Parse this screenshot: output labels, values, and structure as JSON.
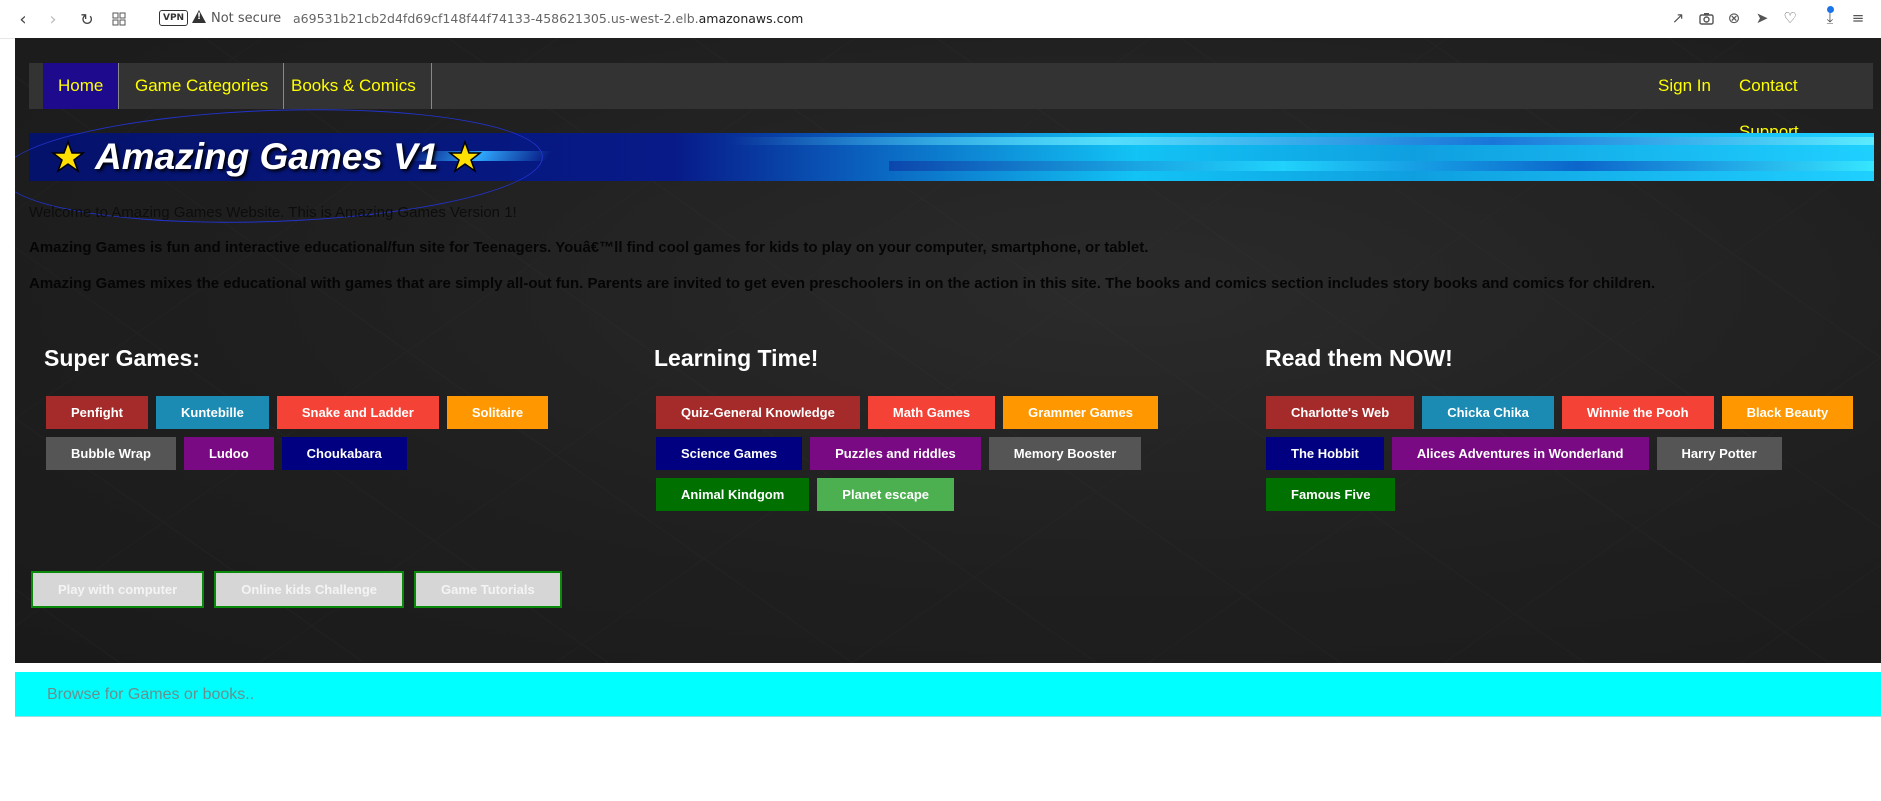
{
  "browser": {
    "vpn_label": "VPN",
    "security_label": "Not secure",
    "url_prefix": "a69531b21cb2d4fd69cf148f44f74133-458621305.us-west-2.elb.",
    "url_domain": "amazonaws.com"
  },
  "nav": {
    "home": "Home",
    "game_categories": "Game Categories",
    "books_comics": "Books & Comics",
    "sign_in": "Sign In",
    "contact_support": "Contact Support"
  },
  "banner": {
    "title": "Amazing Games V1"
  },
  "intro": {
    "welcome": "Welcome to Amazing Games Website. This is Amazing Games Version 1!",
    "line1": "Amazing Games is fun and interactive educational/fun site for Teenagers. Youâ€™ll find cool games for kids to play on your computer, smartphone, or tablet.",
    "line2": "Amazing Games mixes the educational with games that are simply all-out fun. Parents are invited to get even preschoolers in on the action in this site. The books and comics section includes story books and comics for children."
  },
  "sections": {
    "super_games": {
      "title": "Super Games:",
      "items": [
        "Penfight",
        "Kuntebille",
        "Snake and Ladder",
        "Solitaire",
        "Bubble Wrap",
        "Ludoo",
        "Choukabara"
      ]
    },
    "learning": {
      "title": "Learning Time!",
      "items": [
        "Quiz-General Knowledge",
        "Math Games",
        "Grammer Games",
        "Science Games",
        "Puzzles and riddles",
        "Memory Booster",
        "Animal Kindgom",
        "Planet escape"
      ]
    },
    "read": {
      "title": "Read them NOW!",
      "items": [
        "Charlotte's Web",
        "Chicka Chika",
        "Winnie the Pooh",
        "Black Beauty",
        "The Hobbit",
        "Alices Adventures in Wonderland",
        "Harry Potter",
        "Famous Five"
      ]
    }
  },
  "bottom_buttons": [
    "Play with computer",
    "Online kids Challenge",
    "Game Tutorials"
  ],
  "search": {
    "placeholder": "Browse for Games or books.."
  },
  "colors": {
    "nav_bg": "#333333",
    "nav_active": "#1d0a8c",
    "nav_text": "#ffff00",
    "search_bg": "#00ffff"
  },
  "icons": {
    "back": "arrow-left-icon",
    "forward": "arrow-right-icon",
    "reload": "reload-icon",
    "tabs": "grid-icon",
    "star": "star-icon"
  }
}
